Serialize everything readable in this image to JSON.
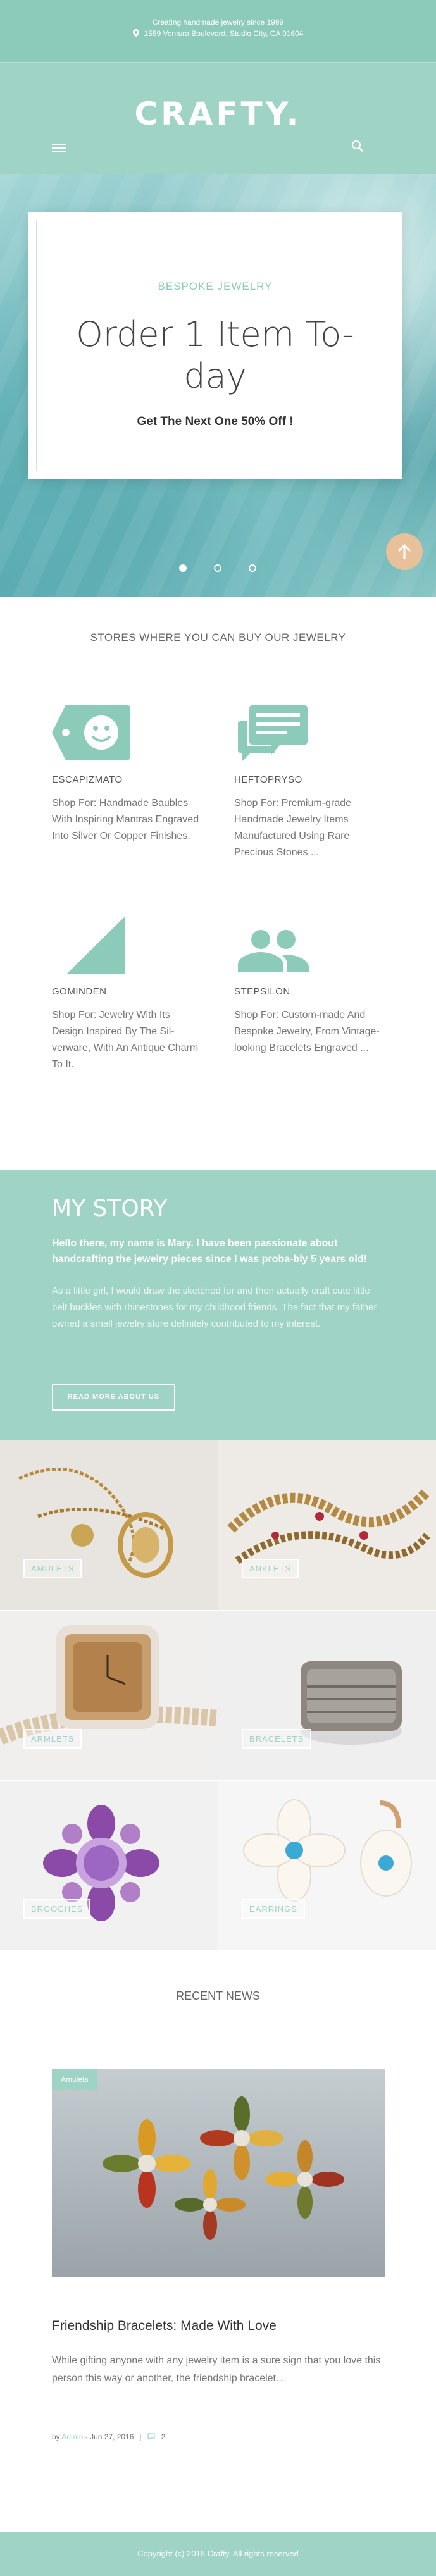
{
  "topbar": {
    "tagline": "Creating handmade jewelry since 1999",
    "address": "1559 Ventura Boulevard, Studio City, CA 91604"
  },
  "header": {
    "logo": "CRAFTY.",
    "menu_icon": "hamburger-menu-icon",
    "search_icon": "search-icon"
  },
  "hero": {
    "kicker": "BESPOKE JEWELRY",
    "title": "Order 1 Item To-day",
    "subtitle": "Get The Next One 50% Off !",
    "slides": 3,
    "active_slide": 1
  },
  "stores": {
    "title": "STORES WHERE YOU CAN BUY OUR JEWELRY",
    "items": [
      {
        "name": "ESCAPIZMATO",
        "text": "Shop For: Handmade Baubles With Inspiring Mantras Engraved Into Silver Or Copper Finishes.",
        "icon": "smiley-tag-icon"
      },
      {
        "name": "HEFTOPRYSO",
        "text": "Shop For: Premium-grade Handmade Jewelry Items Manufactured Using Rare Precious Stones ...",
        "icon": "chat-bubbles-icon"
      },
      {
        "name": "GOMINDEN",
        "text": "Shop For: Jewelry With Its Design Inspired By The Sil-verware, With An Antique Charm To It.",
        "icon": "triangle-icon"
      },
      {
        "name": "STEPSILON",
        "text": "Shop For: Custom-made And Bespoke Jewelry, From Vintage-looking Bracelets Engraved ...",
        "icon": "people-icon"
      }
    ]
  },
  "story": {
    "title": "MY STORY",
    "lead": "Hello there, my name is Mary. I have been passionate about handcrafting the jewelry pieces since I was proba-bly 5 years old!",
    "body": "As a little girl, I would draw the sketched for and then actually craft cute little belt buckles with rhinestones for my childhood friends. The fact that my father owned a small jewelry store definitely contributed to my interest.",
    "button": "READ MORE ABOUT US"
  },
  "categories": [
    "AMULETS",
    "ANKLETS",
    "ARMLETS",
    "BRACELETS",
    "BROOCHES",
    "EARRINGS"
  ],
  "news": {
    "title": "RECENT NEWS",
    "tag": "Amulets",
    "headline": "Friendship Bracelets: Made With Love",
    "excerpt": "While gifting anyone with any jewelry item is a sure sign that you love this person this way or another, the friendship bracelet...",
    "by": "by",
    "author": "Admin",
    "date": "Jun 27, 2016",
    "comments": "2"
  },
  "footer": {
    "copyright": "Copyright (c) 2018 Crafty. All rights reserved"
  },
  "colors": {
    "teal": "#9fd3c5",
    "accent_button": "#e8c09a"
  }
}
